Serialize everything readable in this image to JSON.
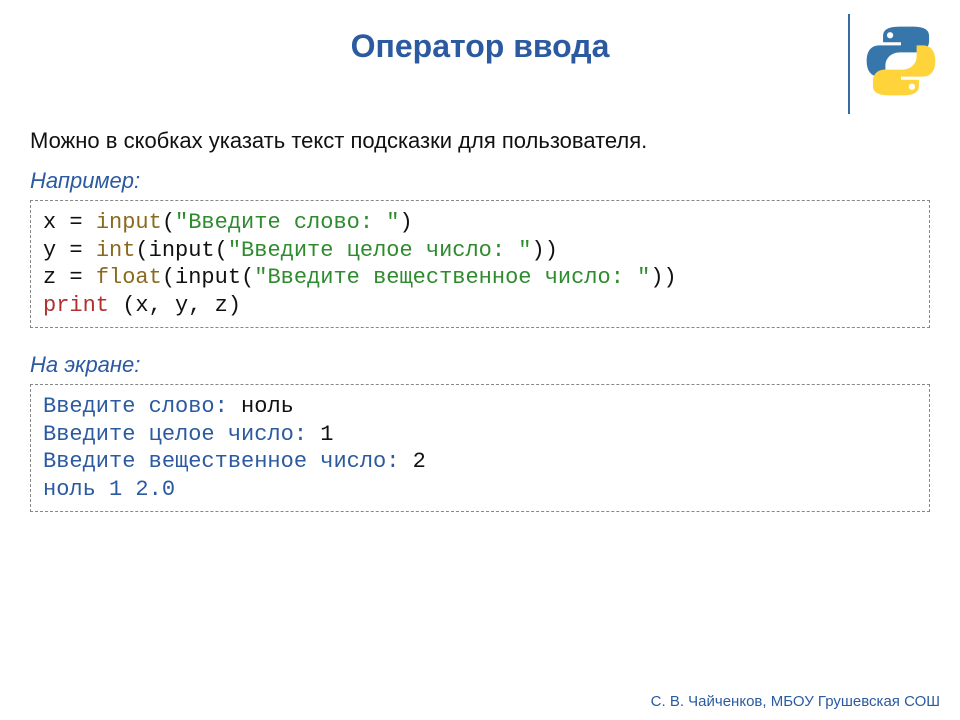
{
  "title": "Оператор ввода",
  "intro": "Можно в скобках указать текст подсказки для пользователя.",
  "label_example": "Например:",
  "label_screen": "На экране:",
  "code": {
    "l1": {
      "a": "x = ",
      "fn": "input",
      "b": "(",
      "s": "\"Введите слово: \"",
      "c": ")"
    },
    "l2": {
      "a": "y = ",
      "fn": "int",
      "b": "(input(",
      "s": "\"Введите целое число: \"",
      "c": "))"
    },
    "l3": {
      "a": "z = ",
      "fn": "float",
      "b": "(input(",
      "s": "\"Введите вещественное число: \"",
      "c": "))"
    },
    "l4": {
      "fn": "print",
      "args": " (x, y, z)"
    }
  },
  "out": {
    "l1": {
      "p": "Введите слово:",
      "v": " ноль"
    },
    "l2": {
      "p": "Введите целое число:",
      "v": " 1"
    },
    "l3": {
      "p": "Введите вещественное число:",
      "v": " 2"
    },
    "l4": {
      "p": "ноль 1 2.0"
    }
  },
  "footer": "С. В. Чайченков, МБОУ Грушевская СОШ"
}
